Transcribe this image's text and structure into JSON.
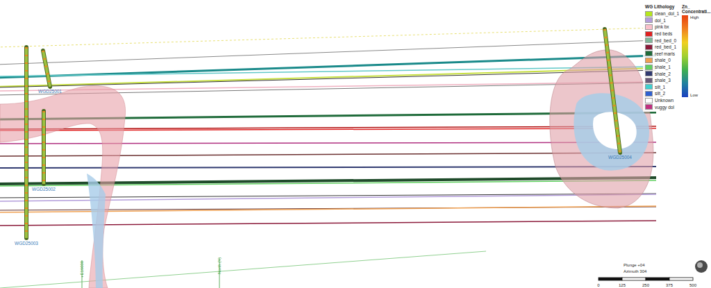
{
  "legend": {
    "title": "WG Lithology",
    "items": [
      {
        "label": "clean_dol_1",
        "color": "#b5e61d"
      },
      {
        "label": "dol_1",
        "color": "#b39ddb"
      },
      {
        "label": "pink bx",
        "color": "#f9c0cb"
      },
      {
        "label": "red beds",
        "color": "#e02020"
      },
      {
        "label": "red_bed_0",
        "color": "#7fb89a"
      },
      {
        "label": "red_bed_1",
        "color": "#8b1a3a"
      },
      {
        "label": "reef marls",
        "color": "#1f6b3a"
      },
      {
        "label": "shale_0",
        "color": "#f0a050"
      },
      {
        "label": "shale_1",
        "color": "#60d060"
      },
      {
        "label": "shale_2",
        "color": "#303a70"
      },
      {
        "label": "shale_3",
        "color": "#6a5a7a"
      },
      {
        "label": "silt_1",
        "color": "#40d0d0"
      },
      {
        "label": "silt_2",
        "color": "#3060d0"
      },
      {
        "label": "Unknown",
        "color": "#ffffff"
      },
      {
        "label": "vuggy dol",
        "color": "#c03080"
      }
    ]
  },
  "colorbar": {
    "title_line1": "Zn_",
    "title_line2": "Concentrati...",
    "high": "High",
    "low": "Low"
  },
  "horizons": [
    {
      "color": "#e8e070"
    },
    {
      "color": "#888888"
    },
    {
      "color": "#1a8a8a"
    },
    {
      "color": "#60c8c8"
    },
    {
      "color": "#c8e040"
    },
    {
      "color": "#333333"
    },
    {
      "color": "#f0b0c0"
    },
    {
      "color": "#777777"
    },
    {
      "color": "#1f6b3a"
    },
    {
      "color": "#b01010"
    },
    {
      "color": "#e02020"
    },
    {
      "color": "#b03080"
    },
    {
      "color": "#6b3030"
    },
    {
      "color": "#303a70"
    },
    {
      "color": "#1f4b2a"
    },
    {
      "color": "#60d060"
    },
    {
      "color": "#333333"
    },
    {
      "color": "#b39ddb"
    },
    {
      "color": "#5a2a2a"
    },
    {
      "color": "#f0a050"
    },
    {
      "color": "#8b1a3a"
    }
  ],
  "drillholes": [
    {
      "label": "WGD25003"
    },
    {
      "label": "WGD25001"
    },
    {
      "label": "WGD25002"
    },
    {
      "label": "WGD25004"
    }
  ],
  "axes": [
    {
      "label": "+E16000"
    },
    {
      "label": "North (Y)"
    }
  ],
  "view": {
    "plunge": "Plunge +04",
    "azimuth": "Azimuth 304"
  },
  "scale": [
    "0",
    "125",
    "250",
    "375",
    "500"
  ]
}
